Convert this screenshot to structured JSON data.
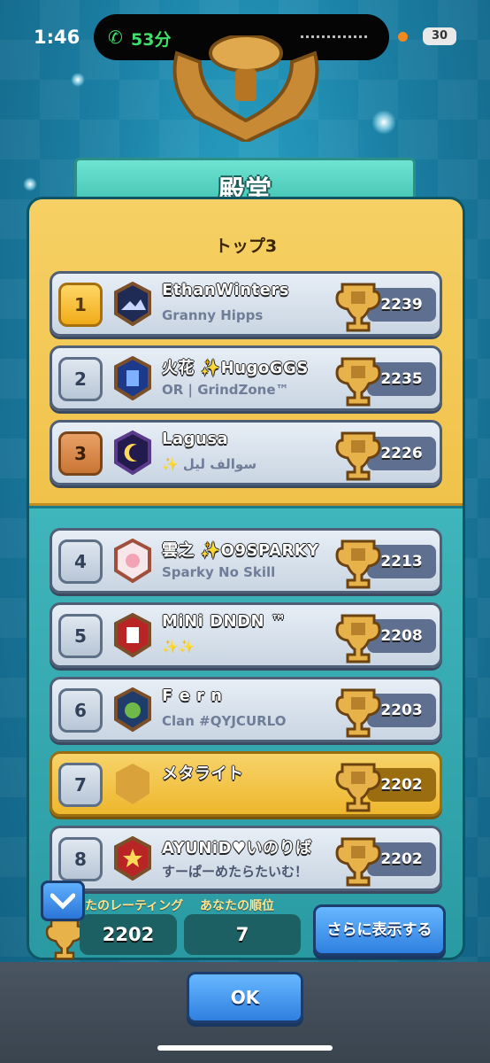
{
  "status": {
    "time": "1:46",
    "call": "53分",
    "battery": "30"
  },
  "title": "殿堂",
  "top3_label": "トップ3",
  "rows": [
    {
      "rank": "1",
      "name": "EthanWinters",
      "clan": "Granny Hipps",
      "score": "2239"
    },
    {
      "rank": "2",
      "name": "火花 ✨HugoGGS",
      "clan": "OR | GrindZone™",
      "score": "2235"
    },
    {
      "rank": "3",
      "name": "Lagusa",
      "clan": "✨ سوالف ليل",
      "score": "2226"
    },
    {
      "rank": "4",
      "name": "雲之 ✨O9SPARKY",
      "clan": "Sparky No Skill",
      "score": "2213"
    },
    {
      "rank": "5",
      "name": "MiNi DNDN ™",
      "clan": "✨✨",
      "score": "2208"
    },
    {
      "rank": "6",
      "name": "F e r n",
      "clan": "Clan #QYJCURLO",
      "score": "2203"
    },
    {
      "rank": "7",
      "name": "メタライト",
      "clan": "",
      "score": "2202"
    },
    {
      "rank": "8",
      "name": "AYUNiD♥いのりば",
      "clan": "すーぱーめたらたいむ！",
      "score": "2202"
    }
  ],
  "bottom": {
    "rating_label": "たのレーティング",
    "rating_value": "2202",
    "rank_label": "あなたの順位",
    "rank_value": "7",
    "more_button": "さらに表示する"
  },
  "ok_button": "OK",
  "colors": {
    "gold": "#f0c24a",
    "teal": "#2a9aa2",
    "blue_button": "#2f7fe0"
  }
}
